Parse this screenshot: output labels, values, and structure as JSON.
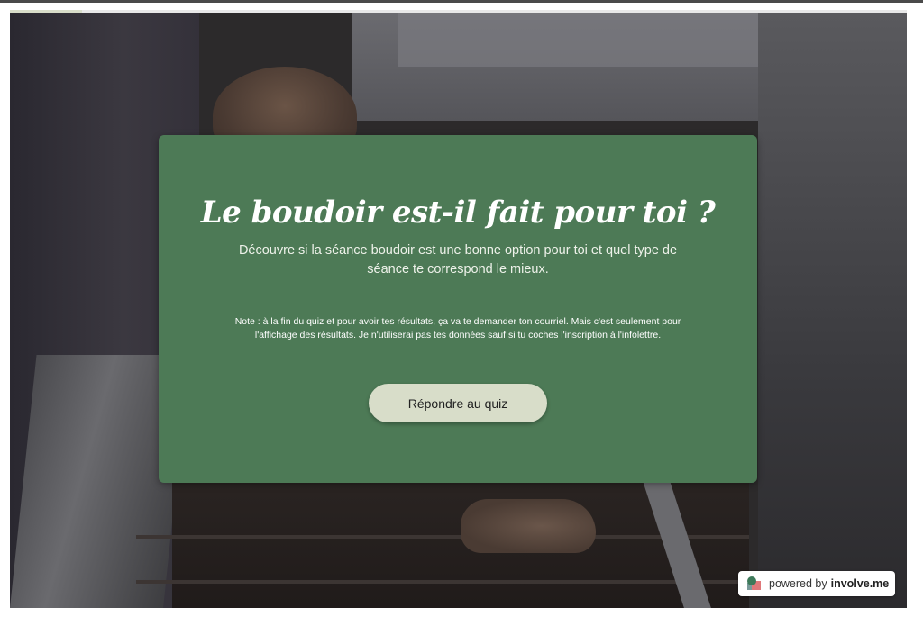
{
  "progress": {
    "fraction": 0.08
  },
  "card": {
    "title": "Le boudoir est-il fait pour toi ?",
    "subtitle": "Découvre si la séance boudoir est une bonne option pour toi et quel type de séance te correspond le mieux.",
    "note": "Note : à la fin du quiz et pour avoir tes résultats, ça va te demander ton courriel. Mais c'est seulement pour l'affichage des résultats. Je n'utiliserai pas tes données sauf si tu coches l'inscription à l'infolettre.",
    "button_label": "Répondre au quiz",
    "background_color": "#4d7a56",
    "button_color": "#d8ddc9"
  },
  "footer": {
    "powered_prefix": "powered by",
    "brand": "involve.me",
    "logo_icon": "involveme-logo-icon"
  }
}
